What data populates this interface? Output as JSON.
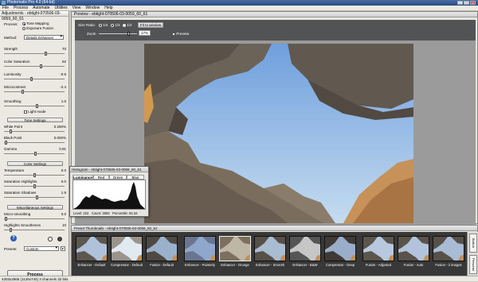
{
  "window": {
    "title": "Photomatix Pro 4.0 (64-bit)",
    "menu": [
      "File",
      "Process",
      "Automate",
      "Utilities",
      "View",
      "Window",
      "Help"
    ]
  },
  "adjustments": {
    "header": "Adjustments - ebtight-070506-03-0059_60_61",
    "process_label": "Process:",
    "process_options": [
      {
        "label": "Tone Mapping",
        "selected": true
      },
      {
        "label": "Exposure Fusion",
        "selected": false
      }
    ],
    "method_label": "Method:",
    "method_value": "Details Enhancer",
    "sliders": [
      {
        "label": "Strength",
        "value": "70",
        "level": 0.7
      },
      {
        "label": "Color Saturation",
        "value": "62",
        "level": 0.62
      },
      {
        "label": "Luminosity",
        "value": "-0.5",
        "level": 0.45
      },
      {
        "label": "Microcontrast",
        "value": "-2.4",
        "level": 0.3
      }
    ],
    "smoothing": {
      "label": "Smoothing",
      "value": "1.0",
      "level": 0.55
    },
    "light_mode_label": "Light mode",
    "tone_settings_label": "Tone Settings",
    "tone_sliders": [
      {
        "label": "White Point",
        "value": "0.250%",
        "level": 0.1
      },
      {
        "label": "Black Point",
        "value": "0.000%",
        "level": 0.02
      },
      {
        "label": "Gamma",
        "value": "0.91",
        "level": 0.52
      }
    ],
    "color_settings_label": "Color Settings",
    "color_sliders": [
      {
        "label": "Temperature",
        "value": "0.0",
        "level": 0.5
      },
      {
        "label": "Saturation Highlights",
        "value": "0.0",
        "level": 0.5
      },
      {
        "label": "Saturation Shadows",
        "value": "1.9",
        "level": 0.55
      }
    ],
    "misc_settings_label": "Miscellaneous Settings",
    "misc_sliders": [
      {
        "label": "Micro-smoothing",
        "value": "0.0",
        "level": 0.02
      },
      {
        "label": "Highlights Smoothness",
        "value": "10",
        "level": 0.1
      }
    ],
    "presets_label": "Presets:",
    "presets_value": "Custom",
    "process_button": "Process"
  },
  "preview": {
    "title": "Preview - ebtight-070506-03-0059_60_61",
    "size_ratio_label": "Size Ratio:",
    "ratios": [
      {
        "label": "1/4",
        "selected": false
      },
      {
        "label": "1/3",
        "selected": false
      },
      {
        "label": "1/2",
        "selected": true
      }
    ],
    "fit_label": "Fit to window",
    "zoom_label": "Zoom",
    "zoom_value": "17%",
    "preview_label": "Preview"
  },
  "histogram": {
    "title": "Histogram - ebtight-070506-03-0059_60_61",
    "tabs": [
      "Luminance",
      "Red",
      "Green",
      "Blue"
    ],
    "level": "Level: 222",
    "count": "Count: 2692",
    "percentile": "Percentile: 84.34"
  },
  "thumbnails": {
    "title": "Preset Thumbnails - ebtight-070506-03-0059_60_61",
    "items": [
      "Enhancer - Default",
      "Compressor - Default",
      "Fusion - Default",
      "Enhancer - Painterly",
      "Enhancer - Grunge",
      "Enhancer - Smooth",
      "Enhancer - B&W",
      "Compressor - Deep",
      "Fusion - Adjusted",
      "Fusion - Auto",
      "Fusion - 2 images"
    ],
    "selected_index": 4,
    "side_tabs": [
      "Built-in",
      "Personal"
    ]
  },
  "status": {
    "text": "4303x2865 (1126x744) 3 channels 32 bits"
  },
  "colors": {
    "titlebar": "#2a4a80",
    "toolbar": "#525354",
    "sky": "#8fb4e2",
    "rock": "#6e655a"
  }
}
